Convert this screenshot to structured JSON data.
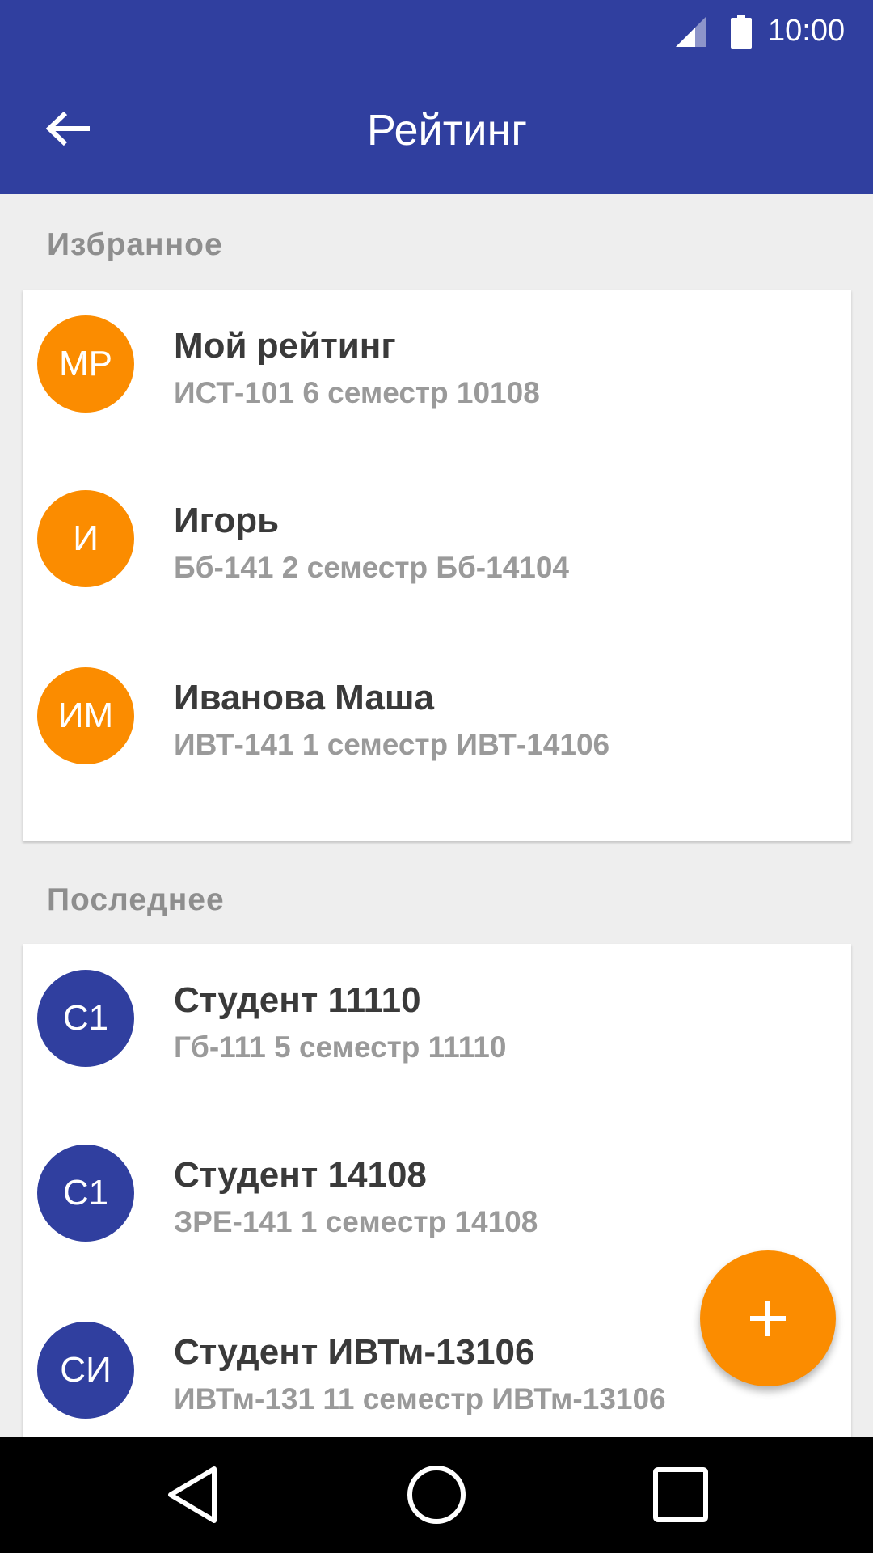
{
  "status_bar": {
    "time": "10:00",
    "icons": [
      "signal-icon",
      "battery-icon"
    ]
  },
  "toolbar": {
    "title": "Рейтинг",
    "back_icon": "arrow-back-icon"
  },
  "favorites": {
    "header": "Избранное",
    "items": [
      {
        "initials": "МР",
        "title": "Мой рейтинг",
        "subtitle": "ИСТ-101 6 семестр 10108",
        "avatar_color": "#fb8c00"
      },
      {
        "initials": "И",
        "title": "Игорь",
        "subtitle": "Бб-141 2 семестр Бб-14104",
        "avatar_color": "#fb8c00"
      },
      {
        "initials": "ИМ",
        "title": "Иванова Маша",
        "subtitle": "ИВТ-141 1 семестр ИВТ-14106",
        "avatar_color": "#fb8c00"
      }
    ]
  },
  "recent": {
    "header": "Последнее",
    "items": [
      {
        "initials": "С1",
        "title": "Студент 11110",
        "subtitle": "Гб-111 5 семестр 11110",
        "avatar_color": "#303f9f"
      },
      {
        "initials": "С1",
        "title": "Студент 14108",
        "subtitle": "ЗРЕ-141 1 семестр 14108",
        "avatar_color": "#303f9f"
      },
      {
        "initials": "СИ",
        "title": "Студент ИВТм-13106",
        "subtitle": "ИВТм-131 11 семестр ИВТм-13106",
        "avatar_color": "#303f9f"
      }
    ]
  },
  "fab": {
    "icon": "plus-icon"
  },
  "nav_bar": {
    "icons": [
      "back-triangle-icon",
      "home-circle-icon",
      "recents-square-icon"
    ]
  },
  "colors": {
    "primary": "#303f9f",
    "accent": "#fb8c00",
    "background": "#eeeeee"
  }
}
